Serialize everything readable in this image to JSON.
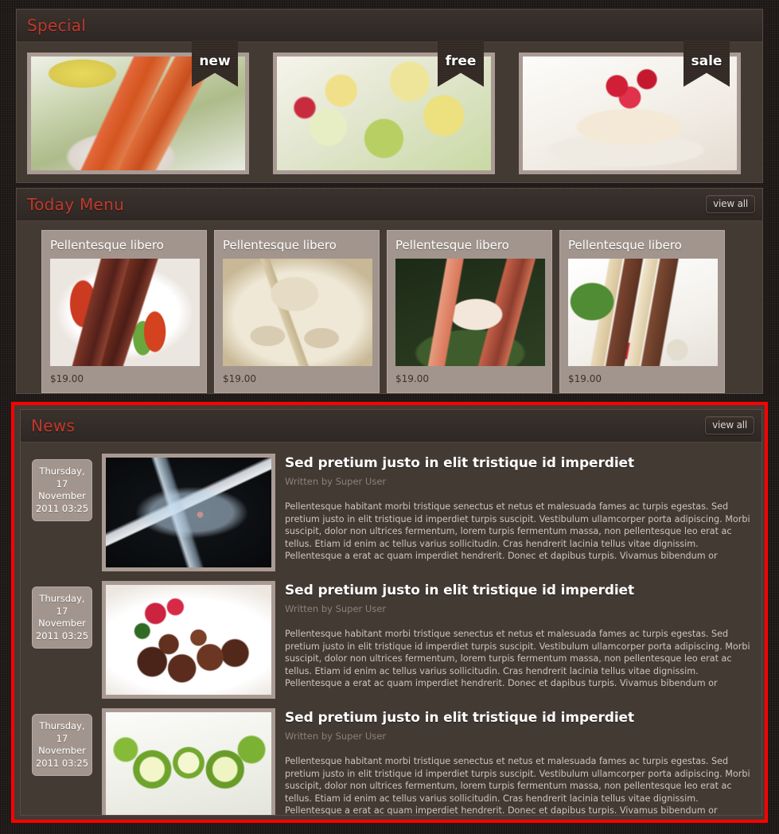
{
  "special": {
    "title": "Special",
    "items": [
      {
        "badge": "new",
        "image": "fried-shrimp-plate"
      },
      {
        "badge": "free",
        "image": "banana-avocado-fruit-plate"
      },
      {
        "badge": "sale",
        "image": "raspberry-dessert-plate"
      }
    ]
  },
  "today_menu": {
    "title": "Today Menu",
    "view_all_label": "view all",
    "items": [
      {
        "name": "Pellentesque libero",
        "price": "$19.00",
        "image": "seared-beef-plate"
      },
      {
        "name": "Pellentesque libero",
        "price": "$19.00",
        "image": "steamed-dumplings"
      },
      {
        "name": "Pellentesque libero",
        "price": "$19.00",
        "image": "nigiri-sushi"
      },
      {
        "name": "Pellentesque libero",
        "price": "$19.00",
        "image": "katsu-sandwich"
      }
    ]
  },
  "news": {
    "title": "News",
    "view_all_label": "view all",
    "items": [
      {
        "date": "Thursday, 17 November 2011 03:25",
        "title": "Sed pretium justo in elit tristique id imperdiet",
        "author": "Written by Super User",
        "excerpt": "Pellentesque habitant morbi tristique senectus et netus et malesuada fames ac turpis egestas. Sed pretium justo in elit tristique id imperdiet turpis suscipit. Vestibulum ullamcorper porta adipiscing. Morbi suscipit, dolor non ultrices fermentum, lorem turpis fermentum massa, non pellentesque leo erat ac tellus. Etiam id enim ac tellus varius sollicitudin. Cras hendrerit lacinia tellus vitae dignissim. Pellentesque a erat ac quam imperdiet hendrerit. Donec et dapibus turpis. Vivamus bibendum or",
        "image": "splashing-bottle"
      },
      {
        "date": "Thursday, 17 November 2011 03:25",
        "title": "Sed pretium justo in elit tristique id imperdiet",
        "author": "Written by Super User",
        "excerpt": "Pellentesque habitant morbi tristique senectus et netus et malesuada fames ac turpis egestas. Sed pretium justo in elit tristique id imperdiet turpis suscipit. Vestibulum ullamcorper porta adipiscing. Morbi suscipit, dolor non ultrices fermentum, lorem turpis fermentum massa, non pellentesque leo erat ac tellus. Etiam id enim ac tellus varius sollicitudin. Cras hendrerit lacinia tellus vitae dignissim. Pellentesque a erat ac quam imperdiet hendrerit. Donec et dapibus turpis. Vivamus bibendum or",
        "image": "chocolate-truffles"
      },
      {
        "date": "Thursday, 17 November 2011 03:25",
        "title": "Sed pretium justo in elit tristique id imperdiet",
        "author": "Written by Super User",
        "excerpt": "Pellentesque habitant morbi tristique senectus et netus et malesuada fames ac turpis egestas. Sed pretium justo in elit tristique id imperdiet turpis suscipit. Vestibulum ullamcorper porta adipiscing. Morbi suscipit, dolor non ultrices fermentum, lorem turpis fermentum massa, non pellentesque leo erat ac tellus. Etiam id enim ac tellus varius sollicitudin. Cras hendrerit lacinia tellus vitae dignissim. Pellentesque a erat ac quam imperdiet hendrerit. Donec et dapibus turpis. Vivamus bibendum or",
        "image": "lime-slices"
      }
    ]
  },
  "colors": {
    "page_background": "#211c1a",
    "panel_background": "#443a34",
    "panel_header": "#342c28",
    "heading_red": "#c0392b",
    "highlight_border": "#ff0000",
    "card_background": "#a2958d",
    "image_frame": "#a99b93"
  }
}
